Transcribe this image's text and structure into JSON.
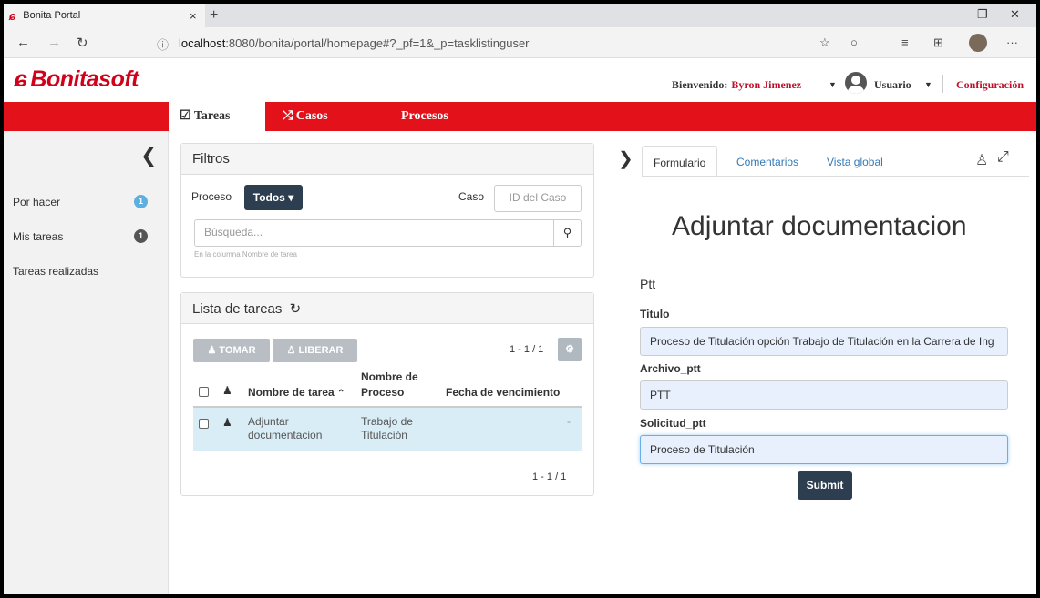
{
  "browser": {
    "tab_title": "Bonita Portal",
    "tab_close": "×",
    "new_tab": "+",
    "url_host": "localhost",
    "url_rest": ":8080/bonita/portal/homepage#?_pf=1&_p=tasklistinguser"
  },
  "header": {
    "brand": "Bonitasoft",
    "welcome_label": "Bienvenido:",
    "user_name": "Byron Jimenez",
    "profile_label": "Usuario",
    "config_label": "Configuración"
  },
  "menu": {
    "items": [
      {
        "icon": "☑",
        "label": "Tareas"
      },
      {
        "icon": "⤮",
        "label": "Casos"
      },
      {
        "icon": "",
        "label": "Procesos"
      }
    ]
  },
  "sidebar": {
    "items": [
      {
        "label": "Por hacer",
        "badge": "1"
      },
      {
        "label": "Mis tareas",
        "badge": "1"
      },
      {
        "label": "Tareas realizadas",
        "badge": ""
      }
    ]
  },
  "filters": {
    "title": "Filtros",
    "proceso_label": "Proceso",
    "proceso_value": "Todos",
    "caso_label": "Caso",
    "caso_placeholder": "ID del Caso",
    "search_placeholder": "Búsqueda...",
    "search_hint": "En la columna Nombre de tarea"
  },
  "tasklist": {
    "title": "Lista de tareas",
    "take_label": "TOMAR",
    "release_label": "LIBERAR",
    "pagination": "1 - 1 / 1",
    "columns": [
      "Nombre de tarea",
      "Nombre de Proceso",
      "Fecha de vencimiento"
    ],
    "column_proceso_line1": "Nombre de",
    "column_proceso_line2": "Proceso",
    "rows": [
      {
        "task_line1": "Adjuntar",
        "task_line2": "documentacion",
        "process_line1": "Trabajo de",
        "process_line2": "Titulación",
        "due": "-"
      }
    ],
    "footer_pagination": "1 - 1 / 1"
  },
  "form": {
    "tabs": [
      "Formulario",
      "Comentarios",
      "Vista global"
    ],
    "title": "Adjuntar documentacion",
    "subtitle": "Ptt",
    "fields": [
      {
        "label": "Titulo",
        "value": "Proceso de Titulación opción Trabajo de Titulación en la Carrera de Ing"
      },
      {
        "label": "Archivo_ptt",
        "value": "PTT"
      },
      {
        "label": "Solicitud_ptt",
        "value": "Proceso de Titulación"
      }
    ],
    "submit_label": "Submit"
  },
  "colors": {
    "brand_red": "#e3111a",
    "dark_button": "#2d3e50",
    "badge_blue": "#5bb0e0",
    "selected_row": "#d9edf7"
  }
}
